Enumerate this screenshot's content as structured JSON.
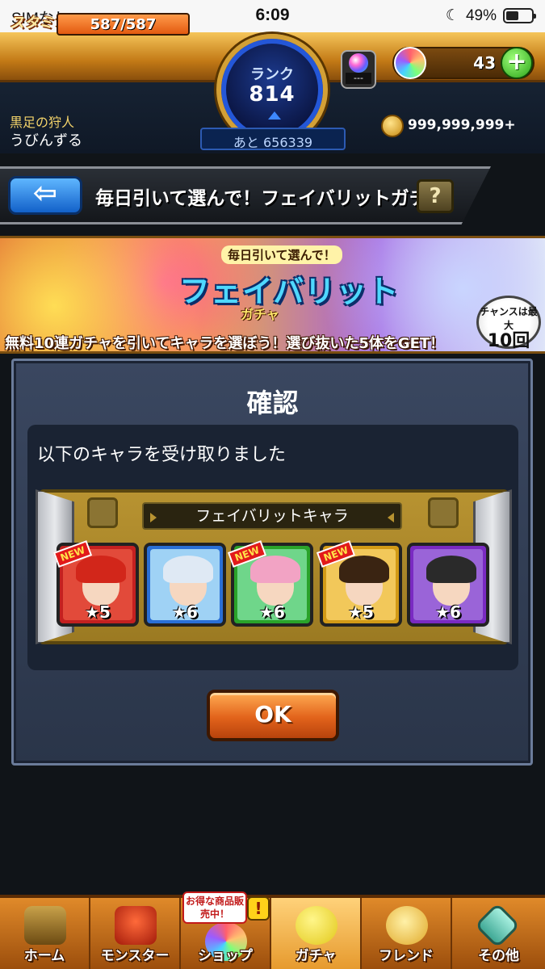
{
  "status_bar": {
    "carrier": "SIMなし",
    "time": "6:09",
    "battery": "49%",
    "battery_level": 0.49
  },
  "hud": {
    "stamina_label": "スタミナ",
    "stamina": "587/587",
    "stamina_level": 1.0,
    "rank_label": "ランク",
    "rank_value": "814",
    "exp_remaining": "あと 656339",
    "speed_value": "---",
    "orb_count": "43",
    "plus": "+",
    "player_title": "黒足の狩人",
    "player_name": "うびんずる",
    "coins": "999,999,999+"
  },
  "title_bar": {
    "back_arrow": "⇦",
    "title": "毎日引いて選んで！フェイバリットガチャ",
    "help": "?"
  },
  "banner": {
    "small": "毎日引いて選んで！",
    "main": "フェイバリット",
    "sub": "ガチャ",
    "tagline": "無料10連ガチャを引いてキャラを選ぼう！選び抜いた5体をGET！",
    "chance_line1": "チャンスは最大",
    "chance_line2": "10回"
  },
  "dialog": {
    "title": "確認",
    "message": "以下のキャラを受け取りました",
    "reward_label": "フェイバリットキャラ",
    "ok": "OK",
    "characters": [
      {
        "stars": "★5",
        "new": "NEW",
        "frame_color": "#c42020",
        "bg": "#e24a3a",
        "hair": "#d2261a"
      },
      {
        "stars": "★6",
        "new": "",
        "frame_color": "#2a6fd6",
        "bg": "#9fd2f5",
        "hair": "#dfe9f4"
      },
      {
        "stars": "★6",
        "new": "NEW",
        "frame_color": "#2aa32a",
        "bg": "#6fd68a",
        "hair": "#f2a3c4"
      },
      {
        "stars": "★5",
        "new": "NEW",
        "frame_color": "#d29a16",
        "bg": "#f2c85a",
        "hair": "#3a2412"
      },
      {
        "stars": "★6",
        "new": "",
        "frame_color": "#7a2ac2",
        "bg": "#9a64d8",
        "hair": "#2a2a2a"
      }
    ]
  },
  "nav": {
    "home": "ホーム",
    "monster": "モンスター",
    "shop": "ショップ",
    "shop_sale": "お得な商品販売中！",
    "shop_alert": "!",
    "gacha": "ガチャ",
    "friend": "フレンド",
    "other": "その他"
  },
  "colors": {
    "accent_orange": "#e2631b",
    "hud_gold": "#c37a16",
    "dialog_bg": "#2a3549"
  }
}
